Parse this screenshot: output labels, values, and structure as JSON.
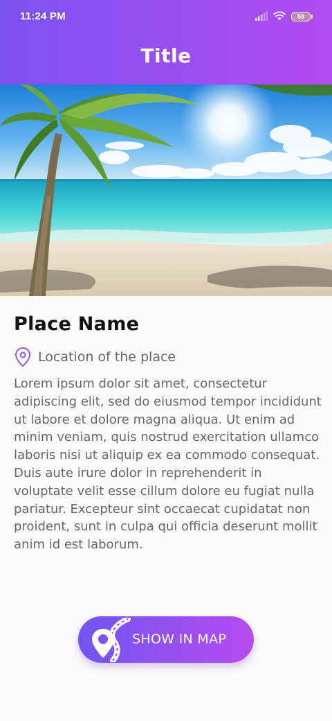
{
  "status_bar": {
    "time": "11:24 PM",
    "battery": "59",
    "icons": [
      "signal-icon",
      "wifi-icon",
      "battery-icon"
    ]
  },
  "header": {
    "title": "Title"
  },
  "hero_image": {
    "subject": "tropical beach with palm tree"
  },
  "place": {
    "name": "Place Name",
    "location": "Location of the place",
    "location_icon": "map-pin-icon",
    "description": "Lorem ipsum dolor sit amet, consectetur adipiscing elit, sed do eiusmod tempor incididunt ut labore et dolore magna aliqua. Ut enim ad minim veniam, quis nostrud exercitation ullamco laboris nisi ut aliquip ex ea commodo consequat. Duis aute irure dolor in reprehenderit in voluptate velit esse cillum dolore eu fugiat nulla pariatur. Excepteur sint occaecat cupidatat non proident, sunt in culpa qui officia deserunt mollit anim id est laborum."
  },
  "map_button": {
    "label": "SHOW IN MAP",
    "icon": "map-route-icon"
  },
  "colors": {
    "accent_start": "#7b52f0",
    "accent_end": "#b24cf0",
    "pin": "#8a5cf0",
    "text_dark": "#111111",
    "text_body": "#676767"
  }
}
